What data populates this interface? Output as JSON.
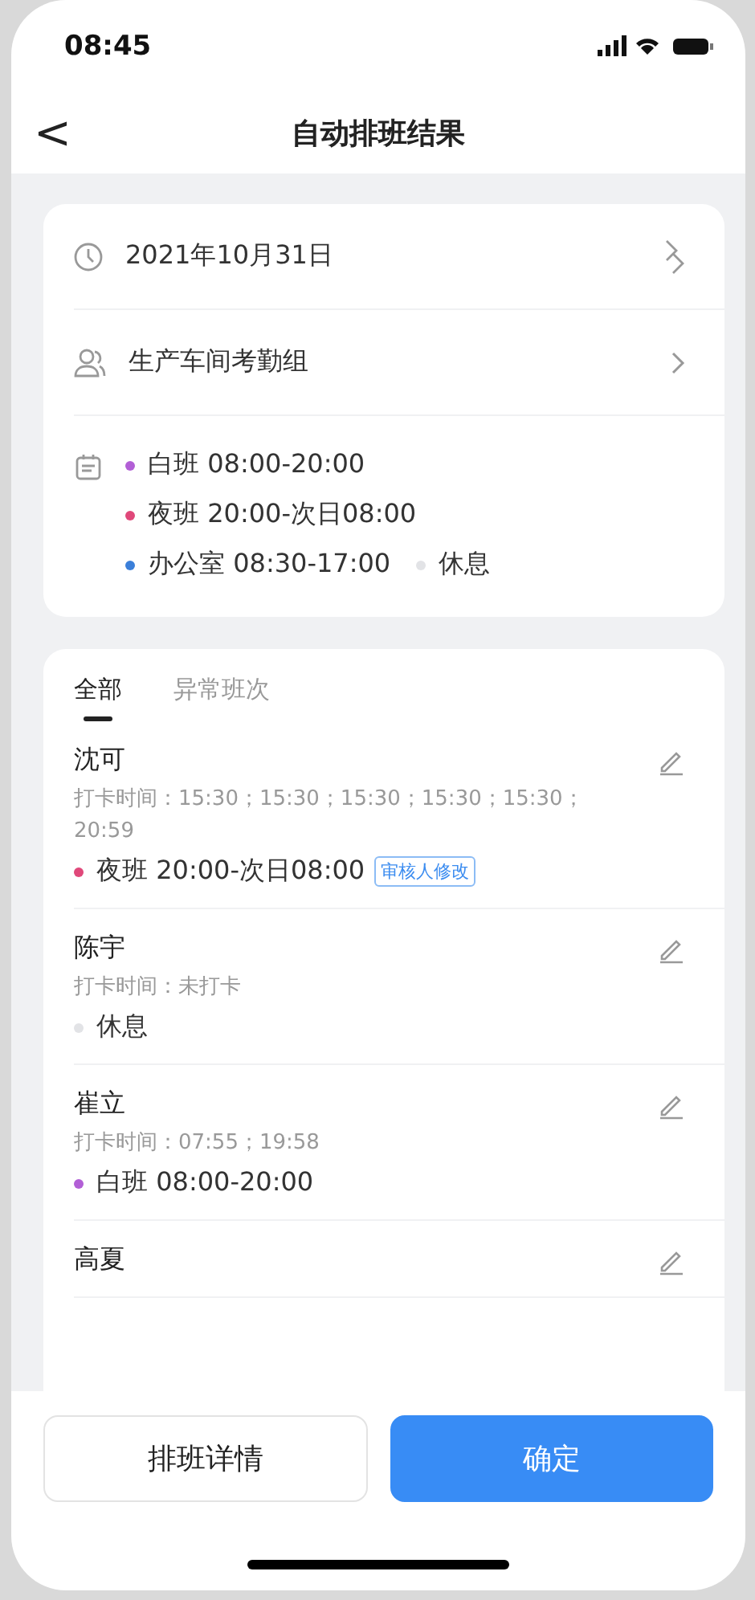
{
  "status_bar": {
    "time": "08:45"
  },
  "nav": {
    "back": "<",
    "title": "自动排班结果"
  },
  "summary": {
    "date": "2021年10月31日",
    "group": "生产车间考勤组",
    "shifts": [
      {
        "label": "白班 08:00-20:00",
        "color": "#b25fd6"
      },
      {
        "label": "夜班 20:00-次日08:00",
        "color": "#e0487a"
      },
      {
        "label": "办公室 08:30-17:00",
        "color": "#3b7fd9"
      },
      {
        "label": "休息",
        "color": "#e2e3e6"
      }
    ]
  },
  "tabs": [
    {
      "label": "全部",
      "selected": true
    },
    {
      "label": "异常班次",
      "selected": false
    }
  ],
  "employees": [
    {
      "name": "沈可",
      "punch": "打卡时间：15:30；15:30；15:30；15:30；15:30；20:59",
      "shift": "夜班 20:00-次日08:00",
      "color": "#e0487a",
      "tag": "审核人修改"
    },
    {
      "name": "陈宇",
      "punch": "打卡时间：未打卡",
      "shift": "休息",
      "color": "#e2e3e6"
    },
    {
      "name": "崔立",
      "punch": "打卡时间：07:55；19:58",
      "shift": "白班 08:00-20:00",
      "color": "#b25fd6"
    },
    {
      "name": "高夏"
    }
  ],
  "buttons": [
    {
      "label": "排班详情",
      "kind": "secondary"
    },
    {
      "label": "确定",
      "kind": "primary"
    }
  ]
}
